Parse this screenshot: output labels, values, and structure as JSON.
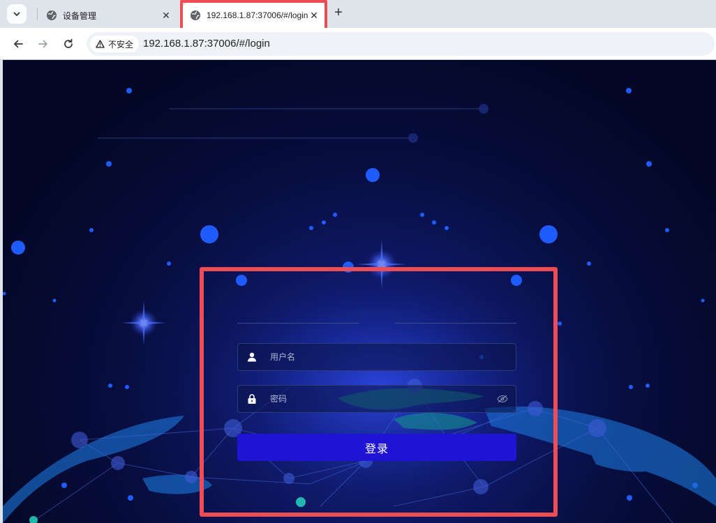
{
  "browser": {
    "tabs": [
      {
        "title": "设备管理",
        "active": false
      },
      {
        "title": "192.168.1.87:37006/#/login",
        "active": true
      }
    ],
    "address_bar": {
      "security_label": "不安全",
      "url": "192.168.1.87:37006/#/login"
    }
  },
  "login": {
    "username_placeholder": "用户名",
    "password_placeholder": "密码",
    "submit_label": "登录"
  },
  "colors": {
    "accent_button": "#1f14d3",
    "highlight_box": "#ef4d55",
    "background_deep": "#040826"
  }
}
